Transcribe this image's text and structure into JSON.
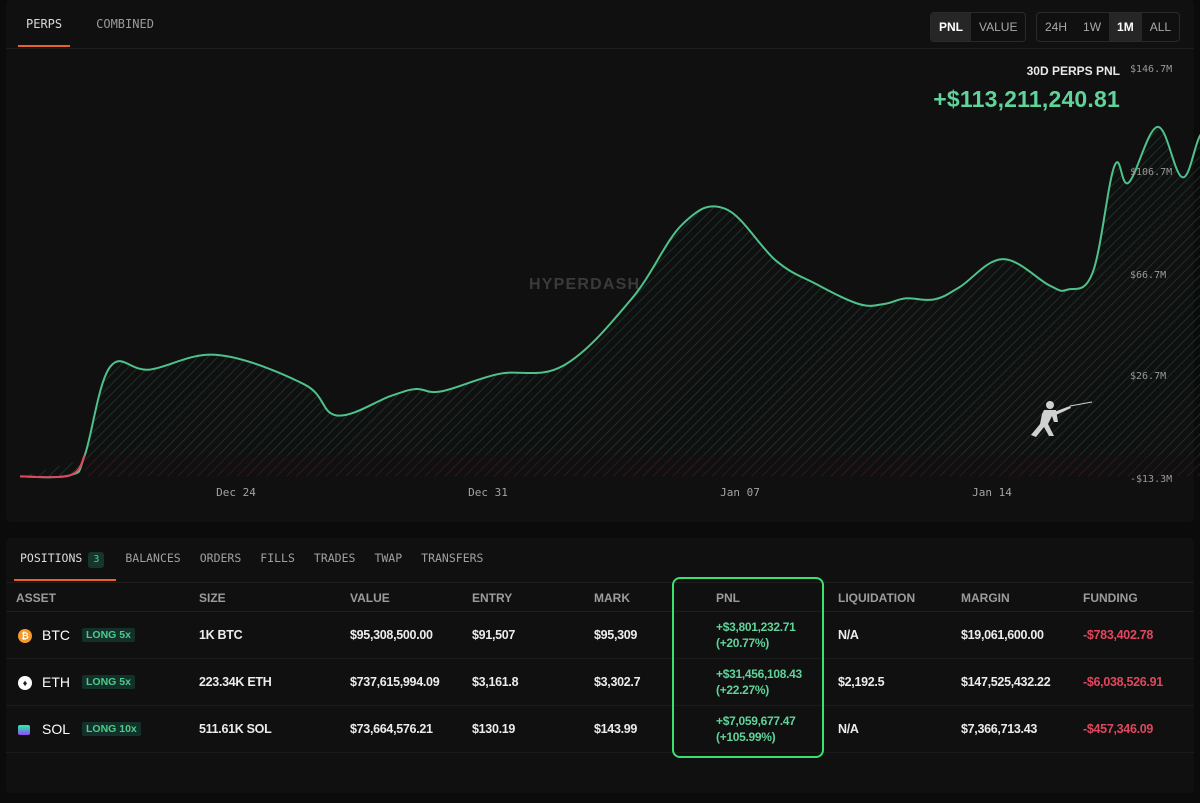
{
  "top_tabs": [
    "PERPS",
    "COMBINED"
  ],
  "metric_toggle": [
    "PNL",
    "VALUE"
  ],
  "range_toggle": [
    "24H",
    "1W",
    "1M",
    "ALL"
  ],
  "summary": {
    "title": "30D PERPS PNL",
    "value": "+$113,211,240.81"
  },
  "watermark": "HYPERDASH",
  "colors": {
    "accent_orange": "#e8622a",
    "positive_green": "#5fd39a",
    "negative_red": "#e0475e",
    "line_red": "#e0475e",
    "highlight_green": "#39e26e"
  },
  "chart_data": {
    "type": "area",
    "title": "30D PERPS PNL",
    "y_ticks": [
      "$146.7M",
      "$106.7M",
      "$66.7M",
      "$26.7M",
      "-$13.3M"
    ],
    "ylim": [
      -13.3,
      146.7
    ],
    "y_unit": "$M",
    "x_ticks": [
      "Dec 24",
      "Dec 31",
      "Jan 07",
      "Jan 14"
    ],
    "x_start": "2024-12-18",
    "points_day_offset": [
      0,
      1.4,
      1.8,
      2.5,
      3.6,
      5.5,
      7.9,
      8.8,
      10.3,
      11.0,
      11.7,
      13.3,
      15.1,
      17.0,
      18.4,
      19.6,
      21.0,
      22.1,
      23.3,
      24.0,
      24.6,
      25.4,
      26.1,
      27.3,
      28.6,
      29.1,
      29.8,
      30.4,
      30.8,
      31.6,
      32.3,
      32.9,
      33.7,
      34.1,
      34.6,
      34.9,
      35.3,
      35.8,
      36.5,
      36.8,
      37.2,
      37.8,
      38.3,
      38.8,
      39.4,
      39.9,
      40.3
    ],
    "values": [
      -12.3,
      -11.8,
      -4.0,
      30.4,
      29.4,
      35.1,
      23.6,
      11.5,
      19.1,
      21.8,
      20.9,
      27.7,
      31.0,
      57.2,
      86.1,
      92.1,
      71.9,
      62.9,
      55.0,
      55.0,
      57.2,
      56.8,
      61.6,
      72.5,
      62.2,
      60.6,
      67.4,
      108.8,
      102.4,
      124.1,
      104.4,
      122.4,
      107.8,
      106.0,
      104.8,
      100.3,
      98.8,
      101.2,
      103.4,
      72.5,
      95.7,
      93.9,
      101.3,
      114.3,
      101.9,
      124.0,
      104.0
    ],
    "final_value": 104.0,
    "line_color": "#4fc28c",
    "negative_segment_color": "#e0475e"
  },
  "bottom_tabs": [
    {
      "label": "POSITIONS",
      "count": "3"
    },
    {
      "label": "BALANCES"
    },
    {
      "label": "ORDERS"
    },
    {
      "label": "FILLS"
    },
    {
      "label": "TRADES"
    },
    {
      "label": "TWAP"
    },
    {
      "label": "TRANSFERS"
    }
  ],
  "table": {
    "headers": [
      "ASSET",
      "SIZE",
      "VALUE",
      "ENTRY",
      "MARK",
      "PNL",
      "LIQUIDATION",
      "MARGIN",
      "FUNDING"
    ],
    "rows": [
      {
        "icon": "bitcoin-icon",
        "asset": "BTC",
        "lev": "LONG 5x",
        "size": "1K BTC",
        "value": "$95,308,500.00",
        "entry": "$91,507",
        "mark": "$95,309",
        "pnl": "+$3,801,232.71",
        "pnl_pct": "(+20.77%)",
        "liq": "N/A",
        "margin": "$19,061,600.00",
        "funding": "-$783,402.78"
      },
      {
        "icon": "ethereum-icon",
        "asset": "ETH",
        "lev": "LONG 5x",
        "size": "223.34K ETH",
        "value": "$737,615,994.09",
        "entry": "$3,161.8",
        "mark": "$3,302.7",
        "pnl": "+$31,456,108.43",
        "pnl_pct": "(+22.27%)",
        "liq": "$2,192.5",
        "margin": "$147,525,432.22",
        "funding": "-$6,038,526.91"
      },
      {
        "icon": "solana-icon",
        "asset": "SOL",
        "lev": "LONG 10x",
        "size": "511.61K SOL",
        "value": "$73,664,576.21",
        "entry": "$130.19",
        "mark": "$143.99",
        "pnl": "+$7,059,677.47",
        "pnl_pct": "(+105.99%)",
        "liq": "N/A",
        "margin": "$7,366,713.43",
        "funding": "-$457,346.09"
      }
    ]
  }
}
